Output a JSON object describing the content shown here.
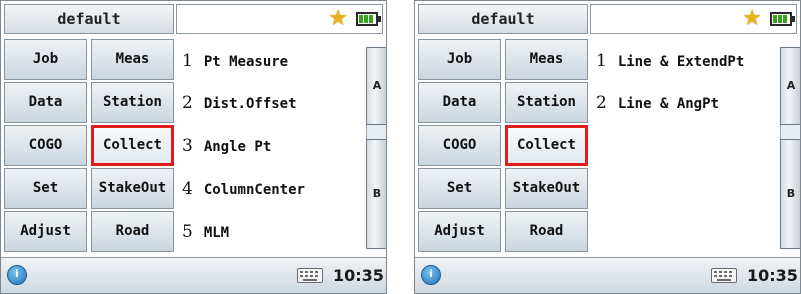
{
  "screens": [
    {
      "title": "default",
      "buttons": [
        "Job",
        "Meas",
        "Data",
        "Station",
        "COGO",
        "Collect",
        "Set",
        "StakeOut",
        "Adjust",
        "Road"
      ],
      "selected": "Collect",
      "list": [
        {
          "num": "1",
          "label": "Pt Measure"
        },
        {
          "num": "2",
          "label": "Dist.Offset"
        },
        {
          "num": "3",
          "label": "Angle Pt"
        },
        {
          "num": "4",
          "label": "ColumnCenter"
        },
        {
          "num": "5",
          "label": "MLM"
        }
      ],
      "scroll_a": "A",
      "scroll_b": "B",
      "time": "10:35"
    },
    {
      "title": "default",
      "buttons": [
        "Job",
        "Meas",
        "Data",
        "Station",
        "COGO",
        "Collect",
        "Set",
        "StakeOut",
        "Adjust",
        "Road"
      ],
      "selected": "Collect",
      "list": [
        {
          "num": "1",
          "label": "Line & ExtendPt"
        },
        {
          "num": "2",
          "label": "Line & AngPt"
        }
      ],
      "scroll_a": "A",
      "scroll_b": "B",
      "time": "10:35"
    }
  ],
  "icons": [
    "star-icon",
    "battery-icon",
    "info-icon",
    "keyboard-icon"
  ],
  "colors": {
    "selection_border": "#e01c1c",
    "star": "#e8b21a",
    "battery": "#3aa21d"
  }
}
